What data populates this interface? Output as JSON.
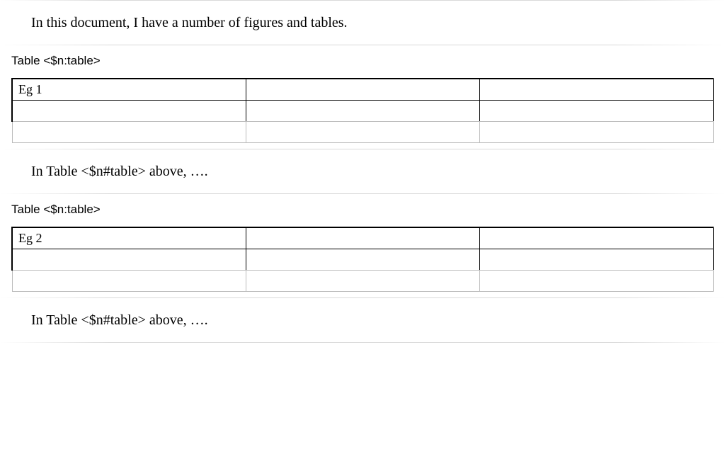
{
  "intro": {
    "text": "In this document, I have a number of figures and tables."
  },
  "tables": [
    {
      "caption": "Table <$n:table>",
      "rows": [
        [
          "Eg 1",
          "",
          ""
        ],
        [
          "",
          "",
          ""
        ],
        [
          "",
          "",
          ""
        ]
      ],
      "followup": "In Table <$n#table> above, …."
    },
    {
      "caption": "Table <$n:table>",
      "rows": [
        [
          "Eg 2",
          "",
          ""
        ],
        [
          "",
          "",
          ""
        ],
        [
          "",
          "",
          ""
        ]
      ],
      "followup": "In Table <$n#table> above, …."
    }
  ]
}
